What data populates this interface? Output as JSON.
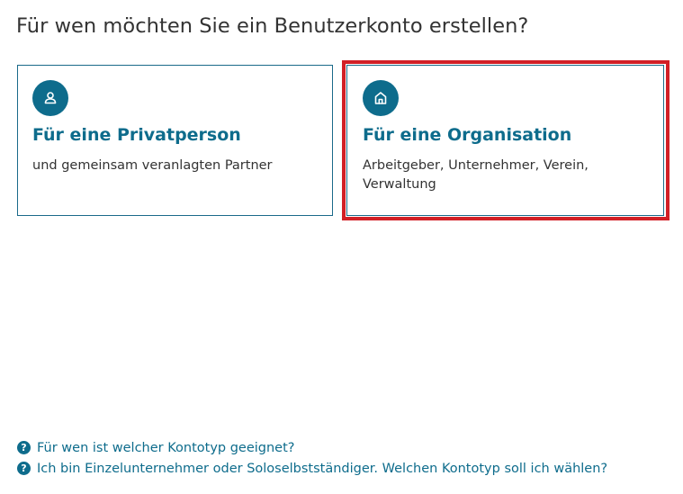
{
  "heading": "Für wen möchten Sie ein Benutzerkonto erstellen?",
  "cards": [
    {
      "title": "Für eine Privatperson",
      "description": "und gemeinsam veranlagten Partner",
      "icon": "person-icon"
    },
    {
      "title": "Für eine Organisation",
      "description": "Arbeitgeber, Unternehmer, Verein, Verwaltung",
      "icon": "house-icon"
    }
  ],
  "help_links": [
    {
      "icon": "question-icon",
      "glyph": "?",
      "text": "Für wen ist welcher Kontotyp geeignet?"
    },
    {
      "icon": "question-icon",
      "glyph": "?",
      "text": "Ich bin Einzelunternehmer oder Soloselbstständiger. Welchen Kontotyp soll ich wählen?"
    }
  ],
  "colors": {
    "accent": "#0e6c8c",
    "highlight": "#d21f26",
    "text": "#333333"
  }
}
